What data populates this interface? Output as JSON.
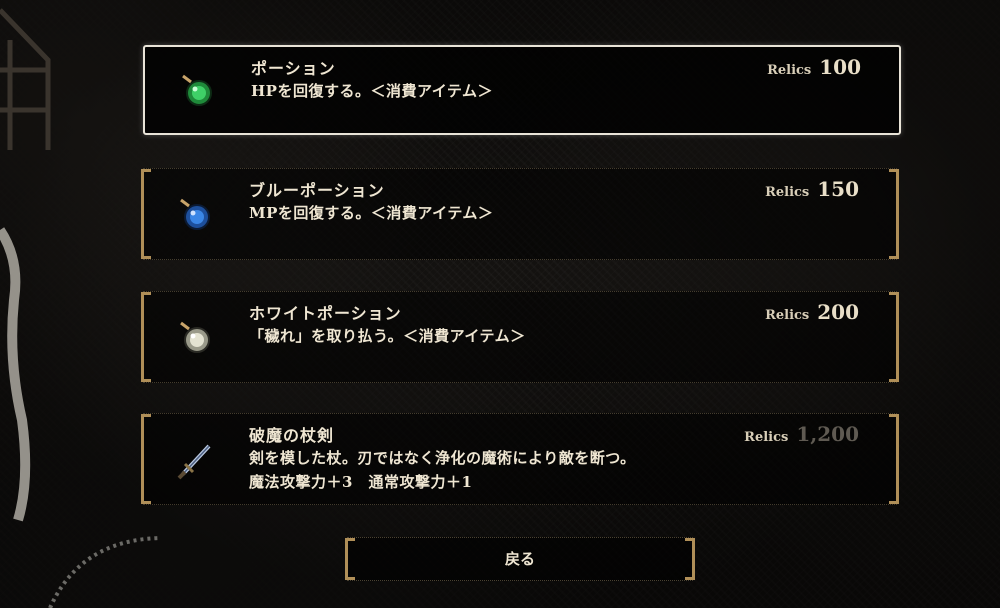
{
  "shop": {
    "currency_label": "Relics",
    "items": [
      {
        "name": "ポーション",
        "desc1": "HPを回復する。＜消費アイテム＞",
        "desc2": "",
        "price": "100",
        "icon": "green-potion-icon",
        "icon_color": "#2fb84c",
        "selected": true,
        "affordable": true
      },
      {
        "name": "ブルーポーション",
        "desc1": "MPを回復する。＜消費アイテム＞",
        "desc2": "",
        "price": "150",
        "icon": "blue-potion-icon",
        "icon_color": "#2f6fd0",
        "selected": false,
        "affordable": true
      },
      {
        "name": "ホワイトポーション",
        "desc1": "「穢れ」を取り払う。＜消費アイテム＞",
        "desc2": "",
        "price": "200",
        "icon": "white-potion-icon",
        "icon_color": "#d9d8c8",
        "selected": false,
        "affordable": true
      },
      {
        "name": "破魔の杖剣",
        "desc1": "剣を模した杖。刃ではなく浄化の魔術により敵を断つ。",
        "desc2": "魔法攻撃力＋3　通常攻撃力＋1",
        "price": "1,200",
        "icon": "sword-icon",
        "icon_color": "#8aa2c8",
        "selected": false,
        "affordable": false
      }
    ]
  },
  "back_button_label": "戻る",
  "colors": {
    "frame_gold": "#b08f58",
    "selected_border": "#e9e4d8",
    "text": "#efe6d2",
    "disabled_price": "#5f5a52"
  }
}
